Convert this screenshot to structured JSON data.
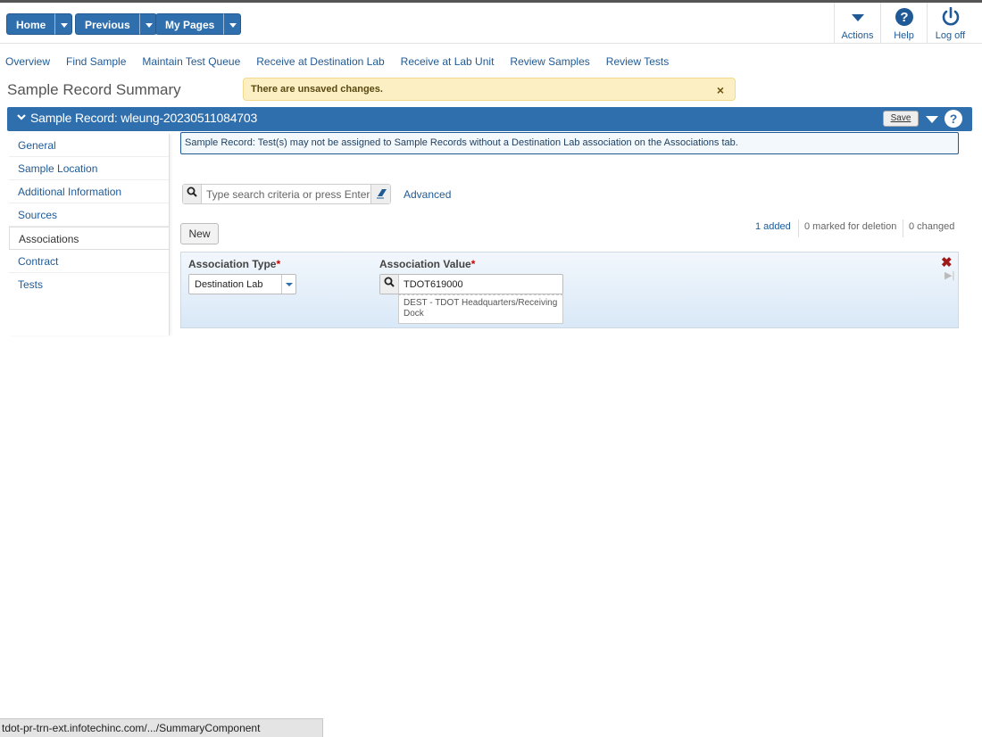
{
  "topbar": {
    "home_label": "Home",
    "previous_label": "Previous",
    "mypages_label": "My Pages",
    "actions_label": "Actions",
    "help_label": "Help",
    "logoff_label": "Log off"
  },
  "links": [
    "Overview",
    "Find Sample",
    "Maintain Test Queue",
    "Receive at Destination Lab",
    "Receive at Lab Unit",
    "Review Samples",
    "Review Tests"
  ],
  "page_title": "Sample Record Summary",
  "unsaved": {
    "text": "There are unsaved changes.",
    "close": "×"
  },
  "record": {
    "title": "Sample Record: wleung-20230511084703",
    "save_label": "Save",
    "help": "?"
  },
  "sidebar": {
    "items": [
      {
        "label": "General"
      },
      {
        "label": "Sample Location"
      },
      {
        "label": "Additional Information"
      },
      {
        "label": "Sources"
      },
      {
        "label": "Associations"
      },
      {
        "label": "Contract"
      },
      {
        "label": "Tests"
      }
    ]
  },
  "info": "Sample Record: Test(s) may not be assigned to Sample Records without a Destination Lab association on the Associations tab.",
  "search": {
    "placeholder": "Type search criteria or press Enter",
    "advanced": "Advanced"
  },
  "new_label": "New",
  "counts": {
    "added": "1 added",
    "deleted": "0 marked for deletion",
    "changed": "0 changed"
  },
  "assoc": {
    "type_label": "Association Type",
    "value_label": "Association Value",
    "required": "*",
    "type_value": "Destination Lab",
    "value": "TDOT619000",
    "description": "DEST - TDOT Headquarters/Receiving Dock"
  },
  "statusbar": "tdot-pr-trn-ext.infotechinc.com/.../SummaryComponent"
}
